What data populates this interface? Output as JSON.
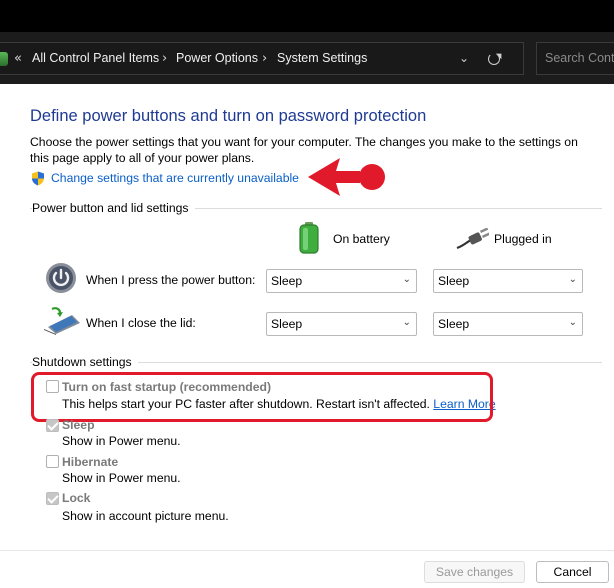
{
  "address_bar": {
    "back_glyph": "«",
    "crumbs": [
      "All Control Panel Items",
      "Power Options",
      "System Settings"
    ],
    "separator": "›",
    "dropdown_glyph": "⌄",
    "search_placeholder": "Search Contr"
  },
  "main": {
    "heading": "Define power buttons and turn on password protection",
    "description": "Choose the power settings that you want for your computer. The changes you make to the settings on this page apply to all of your power plans.",
    "change_link": "Change settings that are currently unavailable"
  },
  "power_group": {
    "label": "Power button and lid settings",
    "col_battery": "On battery",
    "col_plugged": "Plugged in",
    "rows": [
      {
        "label": "When I press the power button:",
        "battery": "Sleep",
        "plugged": "Sleep"
      },
      {
        "label": "When I close the lid:",
        "battery": "Sleep",
        "plugged": "Sleep"
      }
    ],
    "caret": "⌄"
  },
  "shutdown_group": {
    "label": "Shutdown settings",
    "options": [
      {
        "title": "Turn on fast startup (recommended)",
        "sub": "This helps start your PC faster after shutdown. Restart isn't affected.",
        "link": "Learn More",
        "checked": false
      },
      {
        "title": "Sleep",
        "sub": "Show in Power menu.",
        "checked": true
      },
      {
        "title": "Hibernate",
        "sub": "Show in Power menu.",
        "checked": false
      },
      {
        "title": "Lock",
        "sub": "Show in account picture menu.",
        "checked": true
      }
    ]
  },
  "footer": {
    "save_label": "Save changes",
    "cancel_label": "Cancel"
  },
  "colors": {
    "heading": "#1f3a93",
    "link": "#0a5fc8",
    "annotation": "#e01a2a"
  }
}
